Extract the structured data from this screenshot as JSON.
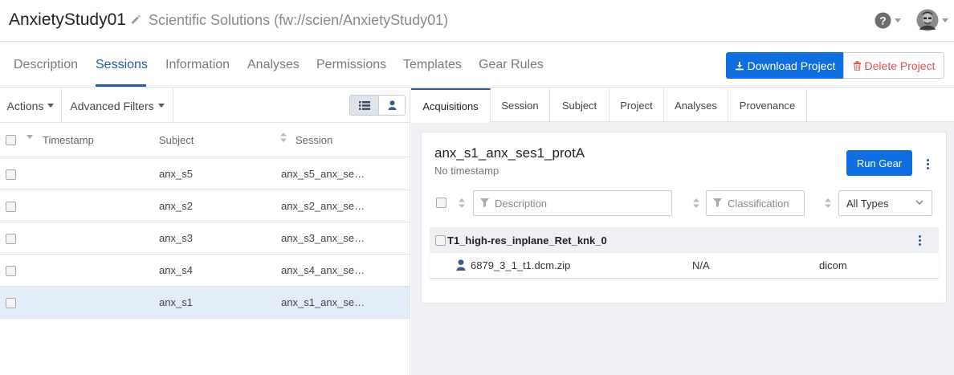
{
  "header": {
    "project_title": "AnxietyStudy01",
    "project_subtitle": "Scientific Solutions (fw://scien/AnxietyStudy01)",
    "help_icon": "question-circle-icon",
    "avatar_icon": "user-avatar"
  },
  "main_tabs": [
    {
      "label": "Description"
    },
    {
      "label": "Sessions",
      "active": true
    },
    {
      "label": "Information"
    },
    {
      "label": "Analyses"
    },
    {
      "label": "Permissions"
    },
    {
      "label": "Templates"
    },
    {
      "label": "Gear Rules"
    }
  ],
  "project_actions": {
    "download_label": "Download Project",
    "delete_label": "Delete Project"
  },
  "left": {
    "actions_label": "Actions",
    "advanced_filters_label": "Advanced Filters",
    "columns": {
      "timestamp": "Timestamp",
      "subject": "Subject",
      "session": "Session"
    },
    "rows": [
      {
        "subject": "anx_s5",
        "session": "anx_s5_anx_se…",
        "selected": false
      },
      {
        "subject": "anx_s2",
        "session": "anx_s2_anx_se…",
        "selected": false
      },
      {
        "subject": "anx_s3",
        "session": "anx_s3_anx_se…",
        "selected": false
      },
      {
        "subject": "anx_s4",
        "session": "anx_s4_anx_se…",
        "selected": false
      },
      {
        "subject": "anx_s1",
        "session": "anx_s1_anx_se…",
        "selected": true
      }
    ]
  },
  "right": {
    "tabs": [
      {
        "label": "Acquisitions",
        "active": true
      },
      {
        "label": "Session"
      },
      {
        "label": "Subject"
      },
      {
        "label": "Project"
      },
      {
        "label": "Analyses"
      },
      {
        "label": "Provenance"
      }
    ],
    "acquisition": {
      "title": "anx_s1_anx_ses1_protA",
      "timestamp": "No timestamp",
      "run_gear_label": "Run Gear",
      "description_placeholder": "Description",
      "classification_placeholder": "Classification",
      "types_value": "All Types",
      "group_name": "T1_high-res_inplane_Ret_knk_0",
      "file": {
        "name": "6879_3_1_t1.dcm.zip",
        "classification": "N/A",
        "type": "dicom"
      }
    }
  },
  "colors": {
    "primary": "#0f6fe0",
    "accent": "#2a5aa0",
    "danger": "#d9534f",
    "selected_row": "#e3edf9"
  }
}
